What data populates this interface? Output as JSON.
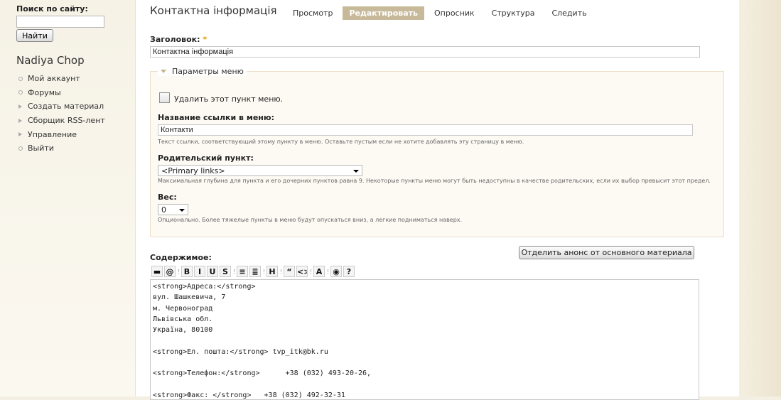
{
  "sidebar": {
    "search_label": "Поиск по сайту:",
    "search_value": "",
    "search_button": "Найти",
    "username": "Nadiya Chop",
    "menu": [
      {
        "label": "Мой аккаунт",
        "bullet": "circle"
      },
      {
        "label": "Форумы",
        "bullet": "circle"
      },
      {
        "label": "Создать материал",
        "bullet": "triangle"
      },
      {
        "label": "Сборщик RSS-лент",
        "bullet": "triangle"
      },
      {
        "label": "Управление",
        "bullet": "triangle"
      },
      {
        "label": "Выйти",
        "bullet": "circle"
      }
    ]
  },
  "header": {
    "title": "Контактна інформація",
    "tabs": [
      {
        "label": "Просмотр",
        "active": false
      },
      {
        "label": "Редактировать",
        "active": true
      },
      {
        "label": "Опросник",
        "active": false
      },
      {
        "label": "Структура",
        "active": false
      },
      {
        "label": "Следить",
        "active": false
      }
    ]
  },
  "form": {
    "title_label": "Заголовок:",
    "required_mark": "*",
    "title_value": "Контактна інформація",
    "menu_fieldset": {
      "legend": "Параметры меню",
      "delete_checkbox_label": "Удалить этот пункт меню.",
      "delete_checked": false,
      "link_title_label": "Название ссылки в меню:",
      "link_title_value": "Контакти",
      "link_title_desc": "Текст ссылки, соответствующий этому пункту в меню. Оставьте пустым если не хотите добавлять эту страницу в меню.",
      "parent_label": "Родительский пункт:",
      "parent_value": "<Primary links>",
      "parent_desc": "Максимальная глубина для пункта и его дочерних пунктов равна 9. Некоторые пункты меню могут быть недоступны в качестве родительских, если их выбор превысит этот предел.",
      "weight_label": "Вес:",
      "weight_value": "0",
      "weight_desc": "Опционально. Более тяжелые пункты в меню будут опускаться вниз, а легкие подниматься наверх."
    },
    "body_label": "Содержимое:",
    "split_button": "Отделить анонс от основного материала",
    "toolbar": [
      {
        "icon": "image-icon",
        "glyph": "▬"
      },
      {
        "icon": "link-icon",
        "glyph": "@"
      },
      {
        "icon": "bold-icon",
        "glyph": "B"
      },
      {
        "icon": "italic-icon",
        "glyph": "I"
      },
      {
        "icon": "underline-icon",
        "glyph": "U"
      },
      {
        "icon": "strike-icon",
        "glyph": "S"
      },
      {
        "icon": "ordered-list-icon",
        "glyph": "≡"
      },
      {
        "icon": "unordered-list-icon",
        "glyph": "≣"
      },
      {
        "icon": "heading-icon",
        "glyph": "H"
      },
      {
        "icon": "quote-icon",
        "glyph": "“"
      },
      {
        "icon": "code-icon",
        "glyph": "<>"
      },
      {
        "icon": "text-color-icon",
        "glyph": "A"
      },
      {
        "icon": "preview-icon",
        "glyph": "◉"
      },
      {
        "icon": "help-icon",
        "glyph": "?"
      }
    ],
    "body_value": "<strong>Адреса:</strong>\nвул. Шашкевича, 7\nм. Червоноград\nЛьвівська обл.\nУкраїна, 80100\n\n<strong>Ел. пошта:</strong> tvp_itk@bk.ru\n\n<strong>Телефон:</strong>      +38 (032) 493-20-26,\n\n<strong>Факс: </strong>   +38 (032) 492-32-31"
  }
}
